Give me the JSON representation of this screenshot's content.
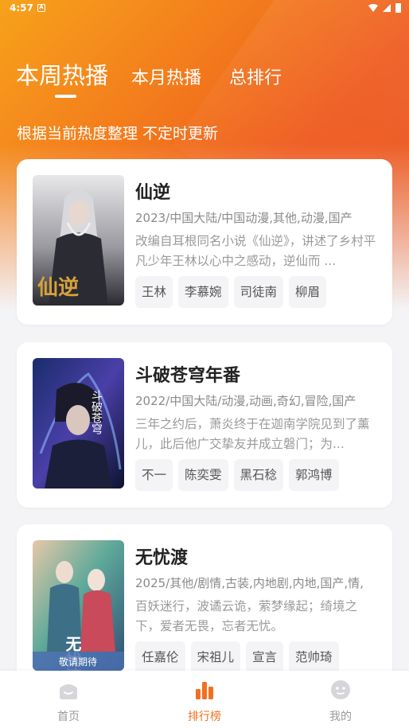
{
  "status_bar": {
    "time": "4:57",
    "notif_glyph": "A"
  },
  "tabs": [
    {
      "label": "本周热播",
      "active": true
    },
    {
      "label": "本月热播",
      "active": false
    },
    {
      "label": "总排行",
      "active": false
    }
  ],
  "subtitle": "根据当前热度整理 不定时更新",
  "items": [
    {
      "title": "仙逆",
      "meta": "2023/中国大陆/中国动漫,其他,动漫,国产",
      "desc": "改编自耳根同名小说《仙逆》，讲述了乡村平凡少年王林以心中之感动，逆仙而 ...",
      "actors": [
        "王林",
        "李慕婉",
        "司徒南",
        "柳眉"
      ],
      "poster_text": "仙逆"
    },
    {
      "title": "斗破苍穹年番",
      "meta": "2022/中国大陆/动漫,动画,奇幻,冒险,国产",
      "desc": "三年之约后，萧炎终于在迦南学院见到了薰儿，此后他广交挚友并成立磐门；为...",
      "actors": [
        "不一",
        "陈奕雯",
        "黑石稔",
        "郭鸿博"
      ],
      "poster_text": "斗破苍穹"
    },
    {
      "title": "无忧渡",
      "meta": "2025/其他/剧情,古装,内地剧,内地,国产,情,",
      "desc": "百妖迷行，波谲云诡，萦梦缘起；绮境之下，爱者无畏，忘者无忧。",
      "actors": [
        "任嘉伦",
        "宋祖儿",
        "宣言",
        "范帅琦"
      ],
      "poster_text": "无忧渡",
      "poster_banner": "敬请期待"
    }
  ],
  "bottom_nav": [
    {
      "label": "首页",
      "icon": "home-icon",
      "active": false
    },
    {
      "label": "排行榜",
      "icon": "ranking-icon",
      "active": true
    },
    {
      "label": "我的",
      "icon": "profile-icon",
      "active": false
    }
  ],
  "colors": {
    "accent": "#f07022",
    "hero_start": "#f7a21b",
    "hero_end": "#e8541f"
  }
}
